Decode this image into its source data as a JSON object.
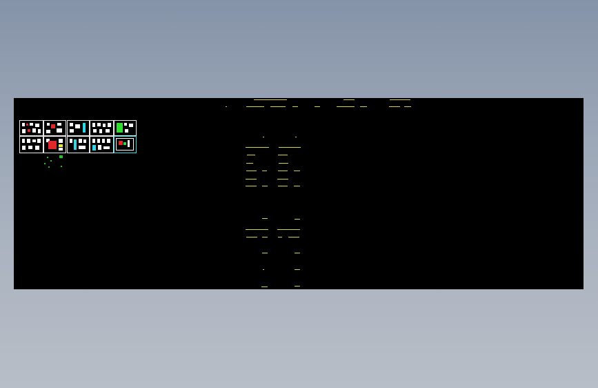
{
  "viewport": {
    "name": "cad-model-space",
    "background_color": "#000000",
    "frame_background": "gradient-gray-blue"
  },
  "colors": {
    "annotation": "#d8d04a",
    "sheet_border": "#e8e8e8",
    "cyan": "#33d6e6",
    "red": "#e02828",
    "green": "#2fdc2f",
    "yellow": "#f0ec30"
  },
  "drawing": {
    "thumbnail_sheet_rows": 2,
    "thumbnail_sheets_per_row": 5,
    "annotation_text_legible": false
  }
}
